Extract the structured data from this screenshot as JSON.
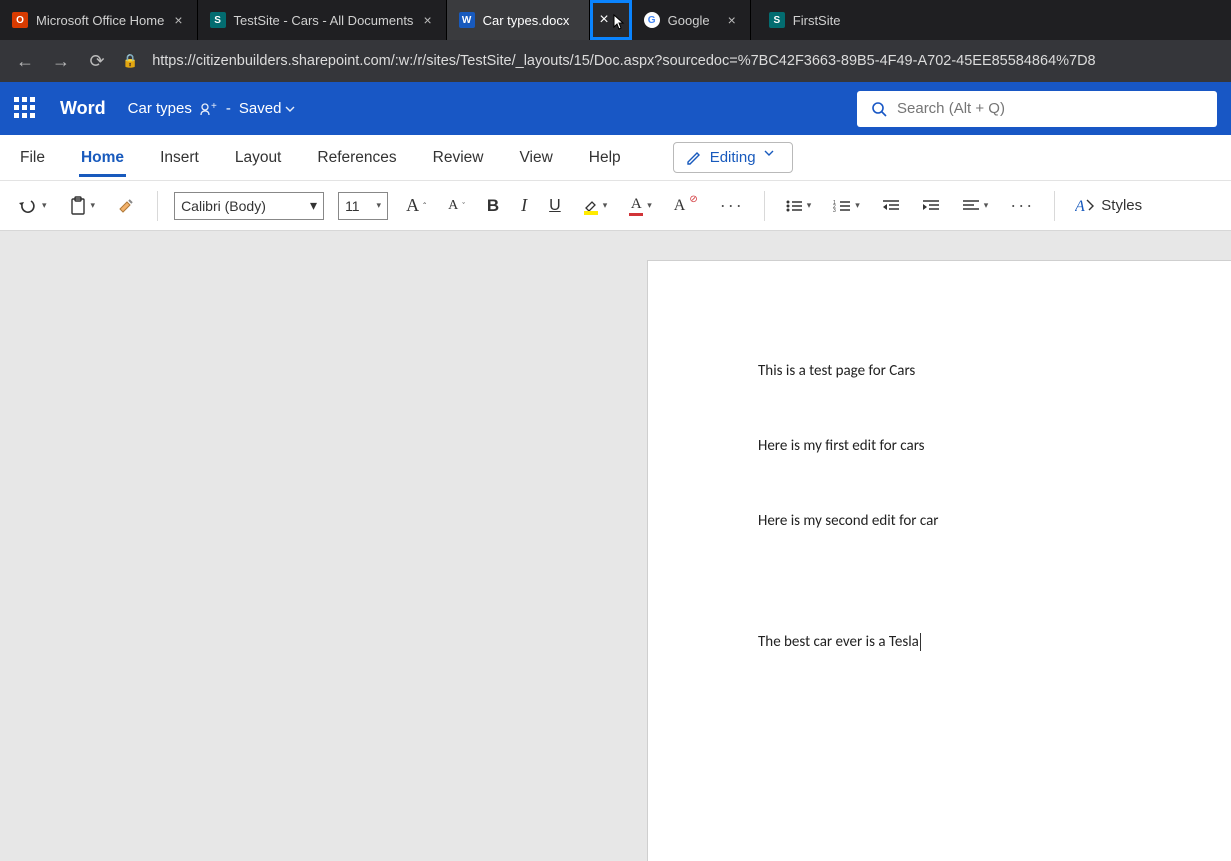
{
  "browser": {
    "tabs": [
      {
        "label": "Microsoft Office Home",
        "favicon_bg": "#d83b01",
        "favicon_text": "O",
        "favicon_color": "#fff"
      },
      {
        "label": "TestSite - Cars - All Documents",
        "favicon_bg": "#036c70",
        "favicon_text": "S",
        "favicon_color": "#fff"
      },
      {
        "label": "Car types.docx",
        "favicon_bg": "#185abd",
        "favicon_text": "W",
        "favicon_color": "#fff",
        "active": true
      },
      {
        "label": "Google",
        "favicon_bg": "#fff",
        "favicon_text": "G",
        "favicon_color": "#4285f4"
      },
      {
        "label": "FirstSite",
        "favicon_bg": "#036c70",
        "favicon_text": "S",
        "favicon_color": "#fff"
      }
    ],
    "url": "https://citizenbuilders.sharepoint.com/:w:/r/sites/TestSite/_layouts/15/Doc.aspx?sourcedoc=%7BC42F3663-89B5-4F49-A702-45EE85584864%7D8"
  },
  "word": {
    "brand": "Word",
    "doc_title": "Car types",
    "saved_label": "Saved",
    "search_placeholder": "Search (Alt + Q)"
  },
  "ribbon": {
    "tabs": [
      "File",
      "Home",
      "Insert",
      "Layout",
      "References",
      "Review",
      "View",
      "Help"
    ],
    "active_tab": "Home",
    "editing_label": "Editing"
  },
  "toolbar": {
    "font_name": "Calibri (Body)",
    "font_size": "11",
    "styles_label": "Styles"
  },
  "document": {
    "paragraphs": [
      "This is a test page for Cars",
      "Here is my first edit for cars",
      "Here is my second edit for car",
      "The best car ever is a Tesla"
    ]
  }
}
